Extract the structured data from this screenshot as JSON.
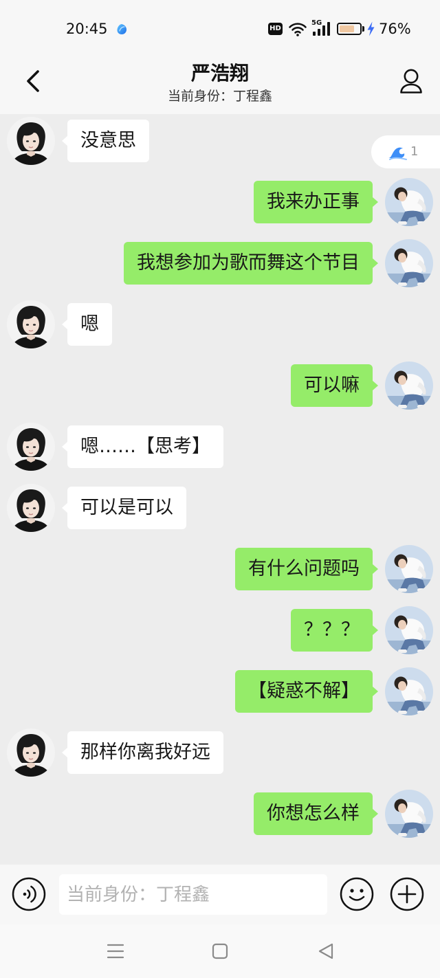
{
  "status_bar": {
    "time": "20:45",
    "hd_label": "HD",
    "network_label": "5G",
    "battery_text": "76%",
    "battery_level": 0.76,
    "icons": {
      "notification": "app-notification-icon",
      "wifi": "wifi-icon",
      "signal": "signal-icon",
      "battery": "battery-icon",
      "charging": "charging-icon"
    }
  },
  "header": {
    "title": "严浩翔",
    "subtitle": "当前身份：丁程鑫",
    "back_icon": "chevron-left-icon",
    "profile_icon": "person-icon"
  },
  "reaction_badge": {
    "icon": "wave-icon",
    "count": "1"
  },
  "messages": [
    {
      "sent": false,
      "text": "没意思"
    },
    {
      "sent": true,
      "text": "我来办正事"
    },
    {
      "sent": true,
      "text": "我想参加为歌而舞这个节目"
    },
    {
      "sent": false,
      "text": "嗯"
    },
    {
      "sent": true,
      "text": "可以嘛"
    },
    {
      "sent": false,
      "text": "嗯……【思考】"
    },
    {
      "sent": false,
      "text": "可以是可以"
    },
    {
      "sent": true,
      "text": "有什么问题吗"
    },
    {
      "sent": true,
      "text": "？？？"
    },
    {
      "sent": true,
      "text": "【疑惑不解】"
    },
    {
      "sent": false,
      "text": "那样你离我好远"
    },
    {
      "sent": true,
      "text": "你想怎么样"
    }
  ],
  "input_bar": {
    "voice_icon": "voice-icon",
    "placeholder": "当前身份：丁程鑫",
    "value": "",
    "emoji_icon": "emoji-icon",
    "plus_icon": "plus-icon"
  },
  "nav_bar": {
    "icons": [
      "menu-icon",
      "square-home-icon",
      "triangle-back-icon"
    ]
  },
  "colors": {
    "chat_background": "#ededed",
    "sent_bubble": "#95ec69",
    "received_bubble": "#ffffff",
    "text": "#191919",
    "bar_background": "#f7f7f7",
    "nav_background": "#f9f9f9",
    "charging": "#3d6df5",
    "reaction_icon": "#3e8ef7",
    "placeholder": "#b2b2b2",
    "battery_fill": "#f0c8a2"
  }
}
